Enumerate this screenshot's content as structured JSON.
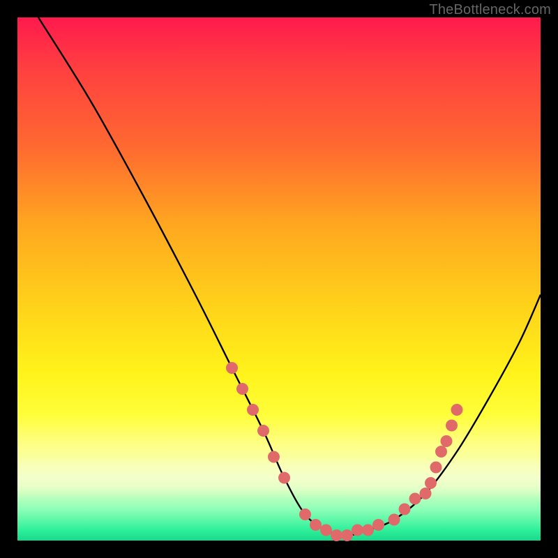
{
  "watermark": "TheBottleneck.com",
  "chart_data": {
    "type": "line",
    "title": "",
    "xlabel": "",
    "ylabel": "",
    "xlim": [
      0,
      100
    ],
    "ylim": [
      0,
      100
    ],
    "grid": false,
    "series": [
      {
        "name": "curve",
        "x": [
          4,
          14,
          24,
          34,
          41,
          47,
          51,
          55,
          59,
          63,
          67,
          72,
          78,
          84,
          90,
          96,
          100
        ],
        "y": [
          100,
          84,
          66,
          47,
          33,
          21,
          12,
          5,
          2,
          1,
          2,
          4,
          9,
          17,
          27,
          38,
          47
        ],
        "color": "#000000"
      }
    ],
    "markers": [
      {
        "x": 41,
        "y": 33
      },
      {
        "x": 43,
        "y": 29
      },
      {
        "x": 45,
        "y": 25
      },
      {
        "x": 47,
        "y": 21
      },
      {
        "x": 49,
        "y": 16
      },
      {
        "x": 51,
        "y": 12
      },
      {
        "x": 55,
        "y": 5
      },
      {
        "x": 57,
        "y": 3
      },
      {
        "x": 59,
        "y": 2
      },
      {
        "x": 61,
        "y": 1
      },
      {
        "x": 63,
        "y": 1
      },
      {
        "x": 65,
        "y": 2
      },
      {
        "x": 67,
        "y": 2
      },
      {
        "x": 69,
        "y": 3
      },
      {
        "x": 72,
        "y": 4
      },
      {
        "x": 74,
        "y": 6
      },
      {
        "x": 76,
        "y": 8
      },
      {
        "x": 78,
        "y": 9
      },
      {
        "x": 79,
        "y": 11
      },
      {
        "x": 80,
        "y": 14
      },
      {
        "x": 81,
        "y": 17
      },
      {
        "x": 82,
        "y": 19
      },
      {
        "x": 83,
        "y": 22
      },
      {
        "x": 84,
        "y": 25
      }
    ],
    "marker_color": "#e06a6a",
    "background": "rainbow-gradient-red-to-green"
  }
}
